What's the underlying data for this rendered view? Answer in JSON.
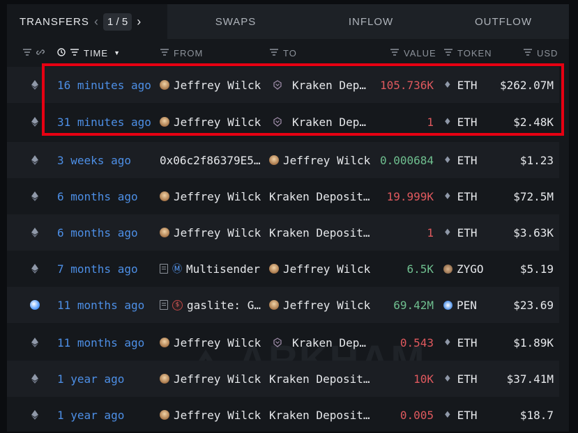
{
  "tabs": {
    "transfers": "TRANSFERS",
    "page_current": "1",
    "page_sep": "/",
    "page_total": "5",
    "swaps": "SWAPS",
    "inflow": "INFLOW",
    "outflow": "OUTFLOW"
  },
  "columns": {
    "time": "TIME",
    "from": "FROM",
    "to": "TO",
    "value": "VALUE",
    "token": "TOKEN",
    "usd": "USD"
  },
  "watermark": "ARKHAM",
  "rows": [
    {
      "chain": "eth",
      "time": "16 minutes ago",
      "from": "Jeffrey Wilck",
      "from_icon": "entity",
      "to": "Kraken Dep…",
      "to_icon": "kraken",
      "value": "105.736K",
      "value_color": "red",
      "token": "ETH",
      "token_icon": "eth",
      "usd": "$262.07M"
    },
    {
      "chain": "eth",
      "time": "31 minutes ago",
      "from": "Jeffrey Wilck",
      "from_icon": "entity",
      "to": "Kraken Dep…",
      "to_icon": "kraken",
      "value": "1",
      "value_color": "red",
      "token": "ETH",
      "token_icon": "eth",
      "usd": "$2.48K"
    },
    {
      "chain": "eth",
      "time": "3 weeks ago",
      "from": "0x06c2f86379E5…",
      "from_icon": "none",
      "to": "Jeffrey Wilck",
      "to_icon": "entity",
      "value": "0.000684",
      "value_color": "green",
      "token": "ETH",
      "token_icon": "eth",
      "usd": "$1.23"
    },
    {
      "chain": "eth",
      "time": "6 months ago",
      "from": "Jeffrey Wilck",
      "from_icon": "entity",
      "to": "Kraken Deposit…",
      "to_icon": "none",
      "value": "19.999K",
      "value_color": "red",
      "token": "ETH",
      "token_icon": "eth",
      "usd": "$72.5M"
    },
    {
      "chain": "eth",
      "time": "6 months ago",
      "from": "Jeffrey Wilck",
      "from_icon": "entity",
      "to": "Kraken Deposit…",
      "to_icon": "none",
      "value": "1",
      "value_color": "red",
      "token": "ETH",
      "token_icon": "eth",
      "usd": "$3.63K"
    },
    {
      "chain": "eth",
      "time": "7 months ago",
      "from": "Multisender",
      "from_icon": "multisender",
      "to": "Jeffrey Wilck",
      "to_icon": "entity",
      "value": "6.5K",
      "value_color": "green",
      "token": "ZYGO",
      "token_icon": "zygo",
      "usd": "$5.19"
    },
    {
      "chain": "dot",
      "time": "11 months ago",
      "from": "gaslite: G…",
      "from_icon": "gaslite",
      "to": "Jeffrey Wilck",
      "to_icon": "entity",
      "value": "69.42M",
      "value_color": "green",
      "token": "PEN",
      "token_icon": "pen",
      "usd": "$23.69"
    },
    {
      "chain": "eth",
      "time": "11 months ago",
      "from": "Jeffrey Wilck",
      "from_icon": "entity",
      "to": "Kraken Dep…",
      "to_icon": "kraken",
      "value": "0.543",
      "value_color": "red",
      "token": "ETH",
      "token_icon": "eth",
      "usd": "$1.89K"
    },
    {
      "chain": "eth",
      "time": "1 year ago",
      "from": "Jeffrey Wilck",
      "from_icon": "entity",
      "to": "Kraken Deposit…",
      "to_icon": "none",
      "value": "10K",
      "value_color": "red",
      "token": "ETH",
      "token_icon": "eth",
      "usd": "$37.41M"
    },
    {
      "chain": "eth",
      "time": "1 year ago",
      "from": "Jeffrey Wilck",
      "from_icon": "entity",
      "to": "Kraken Deposit…",
      "to_icon": "none",
      "value": "0.005",
      "value_color": "red",
      "token": "ETH",
      "token_icon": "eth",
      "usd": "$18.7"
    }
  ]
}
